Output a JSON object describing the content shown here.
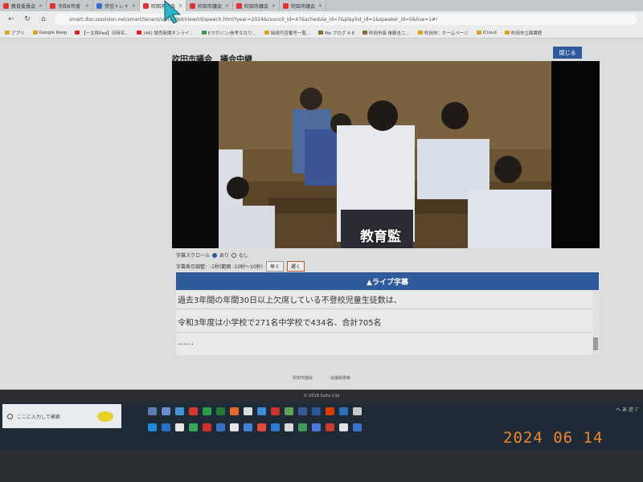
{
  "browser": {
    "tabs": [
      {
        "label": "教育委員会",
        "icon": "red"
      },
      {
        "label": "令和6年度",
        "icon": "red"
      },
      {
        "label": "受信トレイ",
        "icon": "blue"
      },
      {
        "label": "吹田市議会",
        "icon": "red"
      },
      {
        "label": "吹田市議会",
        "icon": "red"
      },
      {
        "label": "吹田市議会",
        "icon": "red"
      },
      {
        "label": "吹田市議会",
        "icon": "red"
      }
    ],
    "url": "smart.discussvision.net/smart/tenant/suita/WebView/rd/speech.html?year=2024&council_id=47&schedule_id=7&playlist_id=1&speaker_id=0&live=1#!",
    "bookmarks": [
      {
        "label": "アプリ",
        "icon": "y"
      },
      {
        "label": "Google Keep",
        "icon": "y"
      },
      {
        "label": "【一太郎Pad】日時名...",
        "icon": "red"
      },
      {
        "label": "(46) 読売新聞オンライ...",
        "icon": "red"
      },
      {
        "label": "Eマガジン/参考ななり...",
        "icon": "g"
      },
      {
        "label": "接続可否番号一覧...",
        "icon": "y"
      },
      {
        "label": "Mo ブログ 4 8",
        "icon": "f"
      },
      {
        "label": "吹田市長 後藤圭二...",
        "icon": "f"
      },
      {
        "label": "吹田市：ホームページ",
        "icon": "y"
      },
      {
        "label": "iCloud",
        "icon": "y"
      },
      {
        "label": "吹田市立図書館",
        "icon": "y"
      }
    ]
  },
  "page": {
    "title": "吹田市議会　議会中継",
    "close_label": "閉じる",
    "caption": "教育監",
    "scroll_label": "字幕スクロール",
    "scroll_on": "あり",
    "scroll_off": "なし",
    "timing_label": "字幕表示調整：-1秒(範囲 -10秒〜10秒)",
    "earlier_label": "早く",
    "later_label": "遅く",
    "live_header": "▲ライブ字幕",
    "live_lines": [
      "過去3年間の年間30日以上欠席している不登校児童生徒数は、",
      "令和3年度は小学校で271名中学校で434名、合計705名",
      "……"
    ],
    "footer_links": [
      "吹田市議会",
      "会議録検索"
    ],
    "copyright": "© 2018 Suita City"
  },
  "taskbar": {
    "search_placeholder": "ここに入力して検索",
    "tray_text": "へ あ 逆 ﾃﾞ"
  },
  "photo": {
    "date_stamp": "2024 06 14"
  }
}
